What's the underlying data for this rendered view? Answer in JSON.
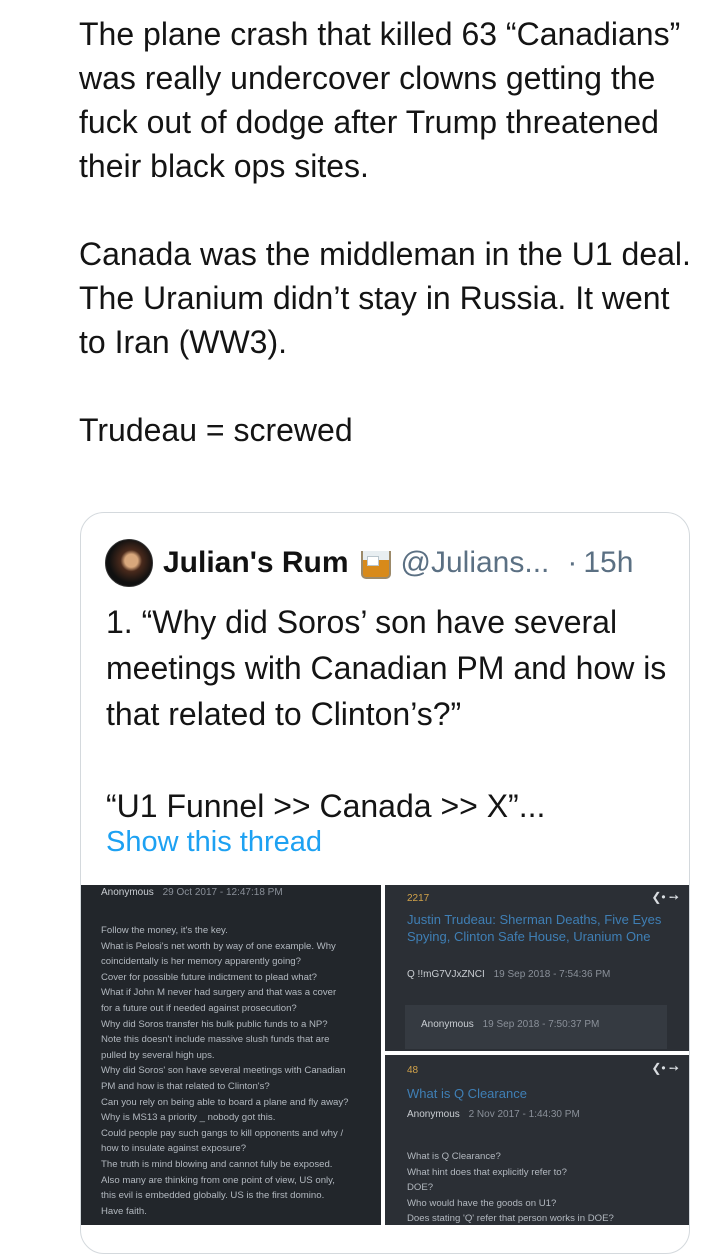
{
  "tweet": {
    "paragraphs": [
      "The plane crash that killed 63 “Canadians” was really undercover clowns getting the fuck out of dodge after Trump threatened their black ops sites.",
      "Canada was the middleman in the U1 deal. The Uranium didn’t stay in Russia. It went to Iran (WW3).",
      "Trudeau = screwed"
    ]
  },
  "quoted": {
    "display_name": "Julian's Rum",
    "name_emoji_icon": "tumbler-glass-icon",
    "handle": "@Julians...",
    "separator": "·",
    "time": "15h",
    "body": [
      "1. “Why did Soros’ son have several meetings with Canadian PM and how is that related to Clinton’s?”",
      "“U1 Funnel >> Canada >> X”..."
    ],
    "show_thread": "Show this thread",
    "images": {
      "left": {
        "anon": "Anonymous",
        "date": "29 Oct 2017 - 12:47:18 PM",
        "lines": [
          "Follow the money, it's the key.",
          "What is Pelosi's net worth by way of one example. Why",
          "coincidentally is her memory apparently going?",
          "Cover for possible future indictment to plead what?",
          "What if John M never had surgery and that was a cover",
          "for a future out if needed against prosecution?",
          "Why did Soros transfer his bulk public funds to a NP?",
          "Note this doesn't include massive slush funds that are",
          "pulled by several high ups.",
          "Why did Soros' son have several meetings with Canadian",
          "PM and how is that related to Clinton's?",
          "Can you rely on being able to board a plane and fly away?",
          "Why is MS13 a priority _ nobody got this.",
          "Could people pay such gangs to kill opponents and why /",
          "how to insulate against exposure?",
          "The truth is mind blowing and cannot fully be exposed.",
          "Also many are thinking from one point of view, US only,",
          "this evil is embedded globally. US is the first domino.",
          "Have faith."
        ]
      },
      "right_top": {
        "number": "2217",
        "title": "Justin Trudeau: Sherman Deaths, Five Eyes Spying, Clinton Safe House, Uranium One",
        "trip": "Q !!mG7VJxZNCI",
        "date": "19 Sep 2018 - 7:54:36 PM",
        "sub_anon": "Anonymous",
        "sub_date": "19 Sep 2018 - 7:50:37 PM"
      },
      "right_bottom": {
        "number": "48",
        "title": "What is Q Clearance",
        "anon": "Anonymous",
        "date": "2 Nov 2017 - 1:44:30 PM",
        "lines": [
          "What is Q Clearance?",
          "What hint does that explicitly refer to?",
          "DOE?",
          "Who would have the goods on U1?",
          "Does stating 'Q' refer that person works in DOE?"
        ]
      }
    }
  }
}
